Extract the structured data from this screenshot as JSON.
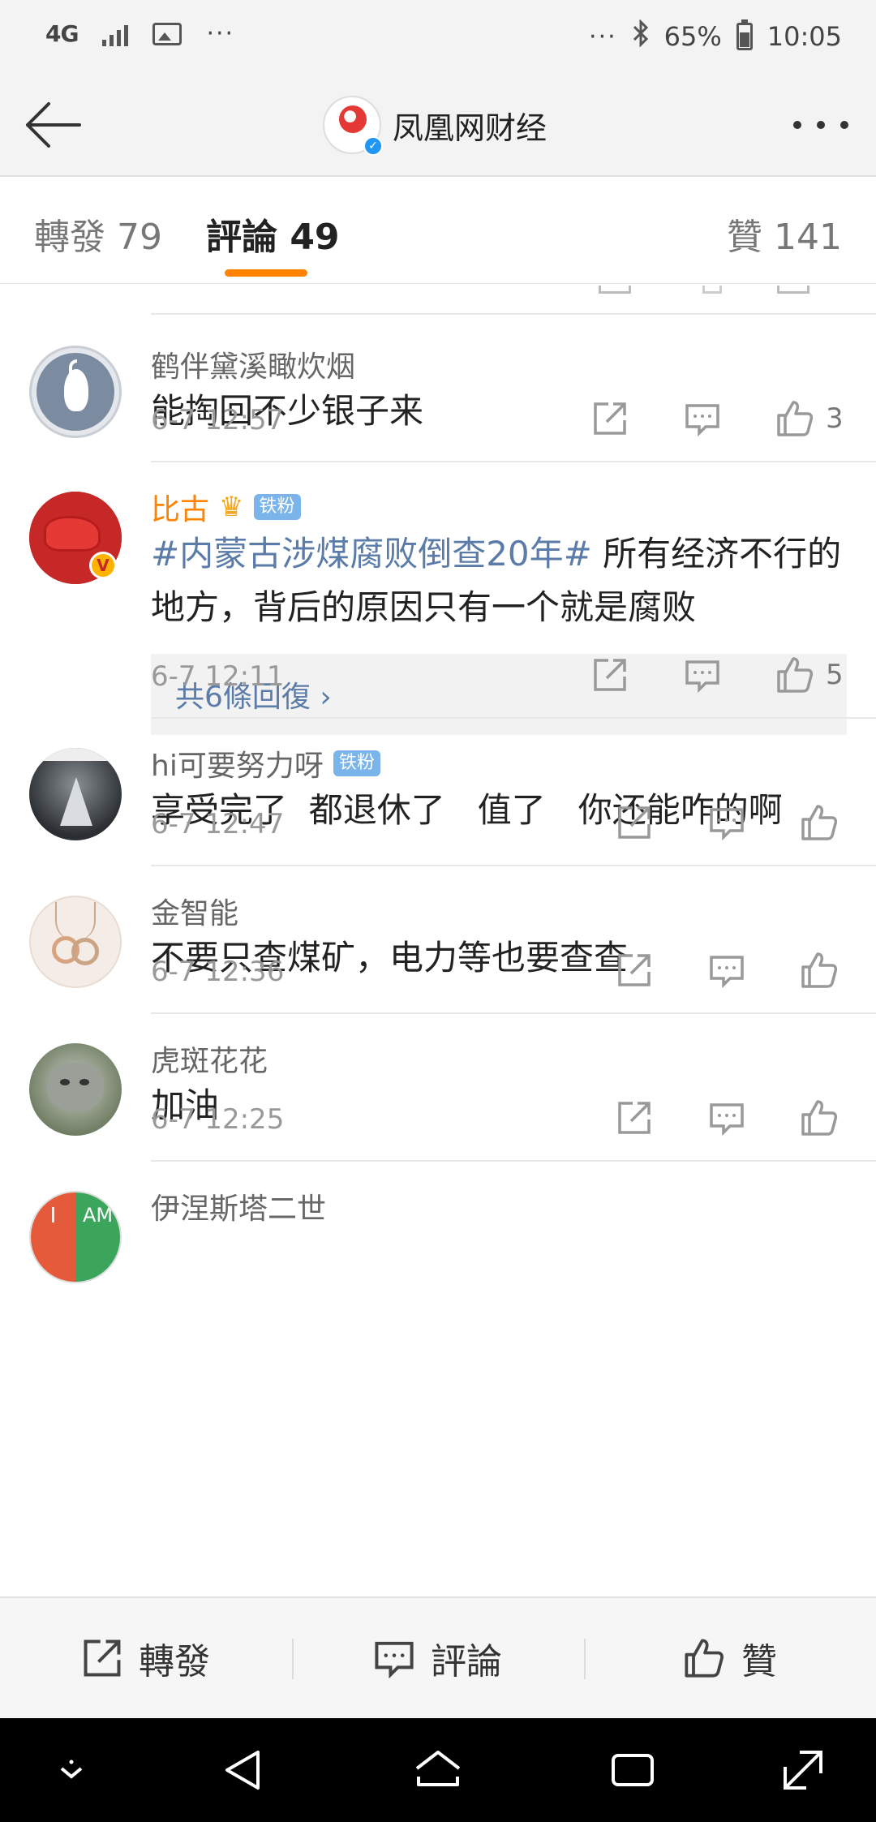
{
  "status_bar": {
    "network": "4G",
    "more": "···",
    "more_right": "···",
    "battery": "65%",
    "time": "10:05"
  },
  "header": {
    "title": "凤凰网财经"
  },
  "tabs": {
    "repost": "轉發 79",
    "comments": "評論 49",
    "likes": "贊 141"
  },
  "comments": [
    {
      "name": "鹤伴黛溪瞰炊烟",
      "text": "能掏回不少银子来",
      "time": "6-7 12:57",
      "likes": "3"
    },
    {
      "name": "比古",
      "badge": "铁粉",
      "topic": "#内蒙古涉煤腐败倒查20年#",
      "text": " 所有经济不行的地方，背后的原因只有一个就是腐败",
      "replies": "共6條回復 ›",
      "time": "6-7 12:11",
      "likes": "5"
    },
    {
      "name": "hi可要努力呀",
      "badge": "铁粉",
      "text": "享受完了  都退休了   值了   你还能咋的啊",
      "time": "6-7 12:47"
    },
    {
      "name": "金智能",
      "text": "不要只查煤矿，电力等也要查查",
      "time": "6-7 12:36"
    },
    {
      "name": "虎斑花花",
      "text": "加油",
      "time": "6-7 12:25"
    },
    {
      "name": "伊涅斯塔二世",
      "avatar_left": "I",
      "avatar_right": "AM"
    }
  ],
  "bottom_bar": {
    "repost": "轉發",
    "comment": "評論",
    "like": "贊"
  },
  "colors": {
    "accent": "#ff8200",
    "topic_link": "#5b7ba8",
    "badge": "#7ab4ea"
  }
}
